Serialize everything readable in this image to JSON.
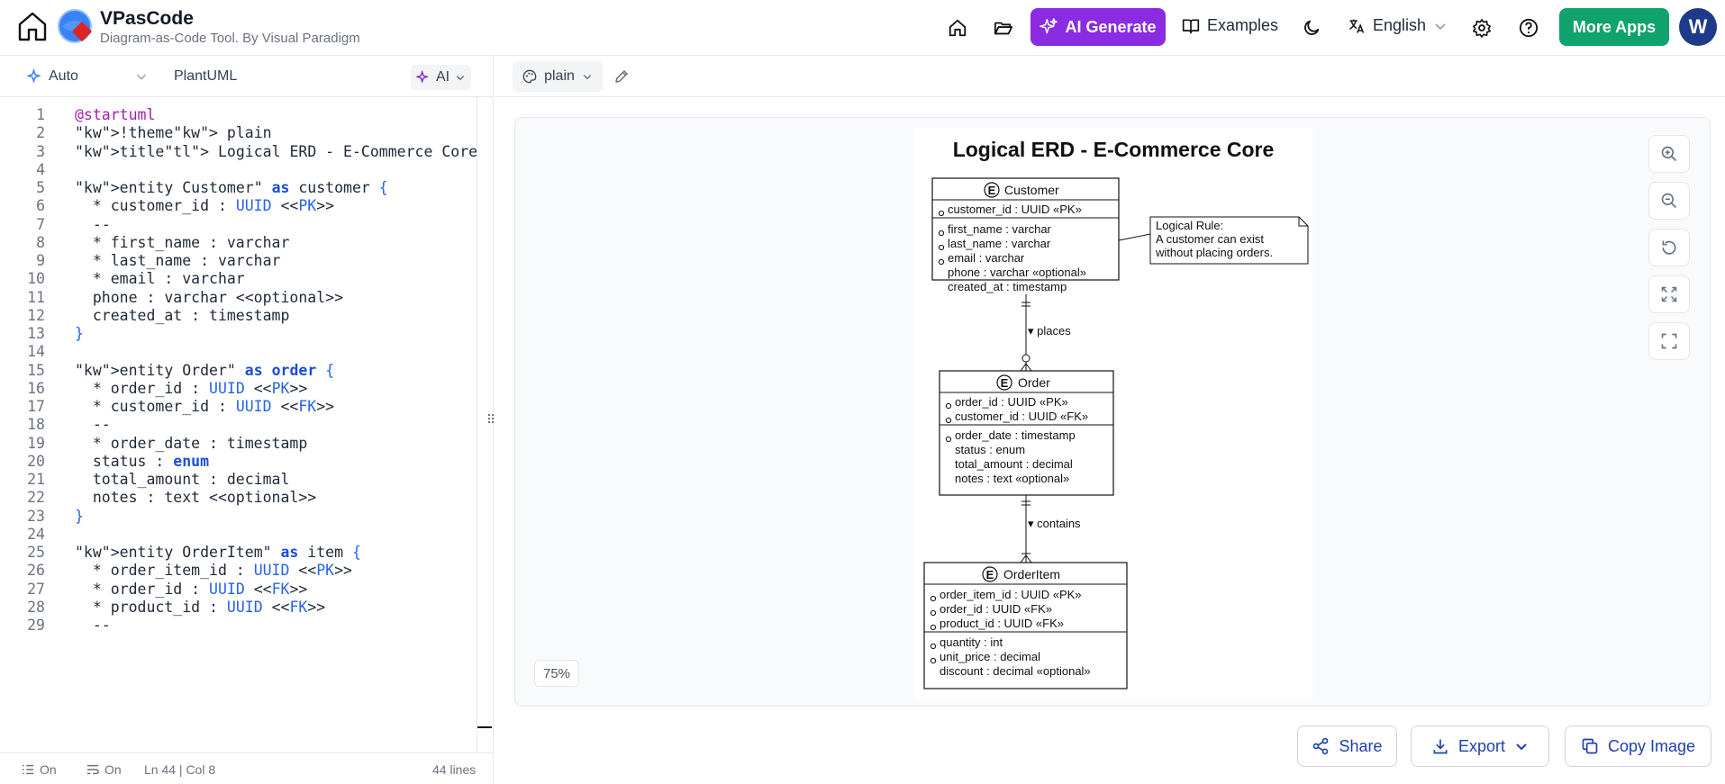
{
  "header": {
    "app_title": "VPasCode",
    "app_subtitle": "Diagram-as-Code Tool. By Visual Paradigm",
    "ai_generate": "AI Generate",
    "examples": "Examples",
    "language": "English",
    "more_apps": "More Apps",
    "avatar_initial": "W",
    "colors": {
      "ai_generate": "#8b2be2",
      "more_apps": "#10a36e",
      "avatar": "#1e3a8a"
    }
  },
  "editor_toolbar": {
    "mode": "Auto",
    "language": "PlantUML",
    "ai": "AI"
  },
  "editor": {
    "lines": [
      {
        "n": "1",
        "t": "@startuml"
      },
      {
        "n": "2",
        "t": "!theme plain"
      },
      {
        "n": "3",
        "t": "title Logical ERD - E-Commerce Core"
      },
      {
        "n": "4",
        "t": ""
      },
      {
        "n": "5",
        "t": "entity \"Customer\" as customer {"
      },
      {
        "n": "6",
        "t": "  * customer_id : UUID <<PK>>"
      },
      {
        "n": "7",
        "t": "  --"
      },
      {
        "n": "8",
        "t": "  * first_name : varchar"
      },
      {
        "n": "9",
        "t": "  * last_name : varchar"
      },
      {
        "n": "10",
        "t": "  * email : varchar"
      },
      {
        "n": "11",
        "t": "  phone : varchar <<optional>>"
      },
      {
        "n": "12",
        "t": "  created_at : timestamp"
      },
      {
        "n": "13",
        "t": "}"
      },
      {
        "n": "14",
        "t": ""
      },
      {
        "n": "15",
        "t": "entity \"Order\" as order {"
      },
      {
        "n": "16",
        "t": "  * order_id : UUID <<PK>>"
      },
      {
        "n": "17",
        "t": "  * customer_id : UUID <<FK>>"
      },
      {
        "n": "18",
        "t": "  --"
      },
      {
        "n": "19",
        "t": "  * order_date : timestamp"
      },
      {
        "n": "20",
        "t": "  status : enum"
      },
      {
        "n": "21",
        "t": "  total_amount : decimal"
      },
      {
        "n": "22",
        "t": "  notes : text <<optional>>"
      },
      {
        "n": "23",
        "t": "}"
      },
      {
        "n": "24",
        "t": ""
      },
      {
        "n": "25",
        "t": "entity \"OrderItem\" as item {"
      },
      {
        "n": "26",
        "t": "  * order_item_id : UUID <<PK>>"
      },
      {
        "n": "27",
        "t": "  * order_id : UUID <<FK>>"
      },
      {
        "n": "28",
        "t": "  * product_id : UUID <<FK>>"
      },
      {
        "n": "29",
        "t": "  --"
      }
    ]
  },
  "status_bar": {
    "wrap": "On",
    "minimap": "On",
    "cursor": "Ln 44 | Col 8",
    "line_count": "44 lines"
  },
  "preview_toolbar": {
    "theme": "plain"
  },
  "zoom_level": "75%",
  "actions": {
    "share": "Share",
    "export": "Export",
    "copy_image": "Copy Image"
  },
  "diagram": {
    "title": "Logical ERD - E-Commerce Core",
    "customer": {
      "name": "Customer",
      "pk": "customer_id : UUID «PK»",
      "fields": [
        "first_name : varchar",
        "last_name : varchar",
        "email : varchar",
        "phone : varchar «optional»",
        "created_at : timestamp"
      ]
    },
    "order": {
      "name": "Order",
      "pk": [
        "order_id : UUID «PK»",
        "customer_id : UUID «FK»"
      ],
      "fields": [
        "order_date : timestamp",
        "status : enum",
        "total_amount : decimal",
        "notes : text «optional»"
      ]
    },
    "item": {
      "name": "OrderItem",
      "pk": [
        "order_item_id : UUID «PK»",
        "order_id : UUID «FK»",
        "product_id : UUID «FK»"
      ],
      "fields": [
        "quantity : int",
        "unit_price : decimal",
        "discount : decimal «optional»"
      ]
    },
    "rel1": "▾ places",
    "rel2": "▾ contains",
    "note_title": "Logical Rule:",
    "note_line1": "A customer can exist",
    "note_line2": "without placing orders.",
    "entity_glyph": "E"
  }
}
